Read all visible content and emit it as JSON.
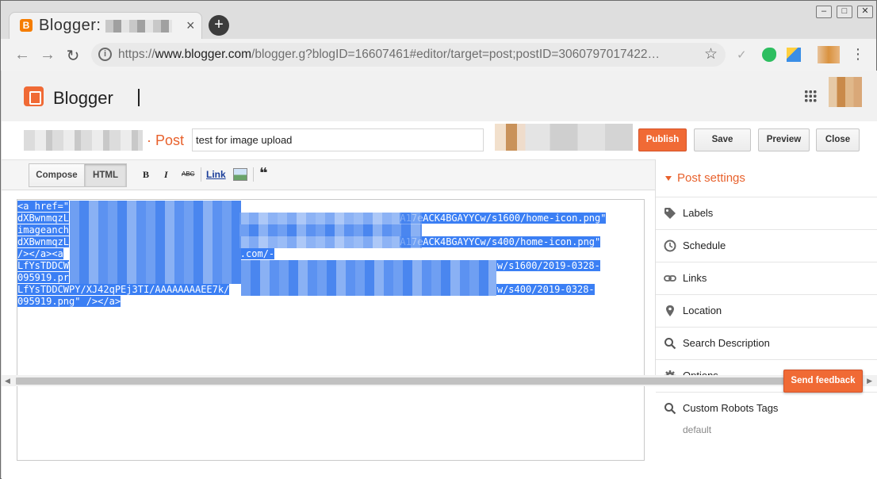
{
  "browser": {
    "tab_title": "Blogger:",
    "tab_close": "×",
    "new_tab": "+",
    "url_prefix": "https://",
    "url_domain": "www.blogger.com",
    "url_rest": "/blogger.g?blogID=16607461#editor/target=post;postID=3060797017422…",
    "win_min": "–",
    "win_max": "□",
    "win_close": "✕",
    "menu": "⋮"
  },
  "header": {
    "app_name": "Blogger"
  },
  "postbar": {
    "post_label": "· Post",
    "title_value": "test for image upload",
    "publish": "Publish",
    "save": "Save",
    "preview": "Preview",
    "close": "Close"
  },
  "editor": {
    "compose_label": "Compose",
    "html_label": "HTML",
    "bold": "B",
    "italic": "I",
    "strike": "ABC",
    "link": "Link",
    "quote": "❝",
    "code_lines": [
      "<a href=\"",
      "dXBwnmqzL",
      "imageanch",
      "dXBwnmqzL",
      "/></a><a",
      "LfYsTDDCW",
      "095919.pr",
      "LfYsTDDCWPY/XJ42qPEj3TI/AAAAAAAAEE7k/",
      "095919.png\" /></a>"
    ],
    "code_tails": [
      "",
      "A17eACK4BGAYYCw/s1600/home-icon.png\"",
      "",
      "A17eACK4BGAYYCw/s400/home-icon.png\"",
      ".com/-",
      "YCw/s1600/2019-0328-",
      "",
      "YCw/s400/2019-0328-",
      ""
    ]
  },
  "sidebar": {
    "title": "Post settings",
    "items": [
      {
        "label": "Labels",
        "icon": "tag-icon"
      },
      {
        "label": "Schedule",
        "icon": "clock-icon"
      },
      {
        "label": "Links",
        "icon": "link-icon"
      },
      {
        "label": "Location",
        "icon": "map-pin-icon"
      },
      {
        "label": "Search Description",
        "icon": "search-icon"
      },
      {
        "label": "Options",
        "icon": "gear-icon"
      },
      {
        "label": "Custom Robots Tags",
        "icon": "search-icon"
      }
    ],
    "robots_value": "default"
  },
  "feedback": "Send feedback",
  "colors": {
    "accent": "#f06a35",
    "accent_text": "#e8612c",
    "selection": "#3b7ff4"
  }
}
